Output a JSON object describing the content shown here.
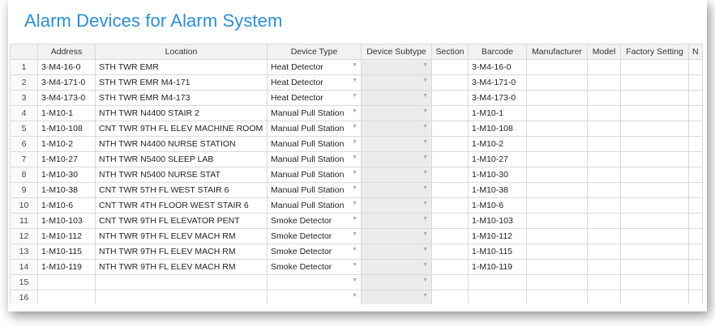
{
  "title": "Alarm Devices for Alarm System",
  "columns": [
    "",
    "Address",
    "Location",
    "Device Type",
    "Device Subtype",
    "Section",
    "Barcode",
    "Manufacturer",
    "Model",
    "Factory Setting",
    "N"
  ],
  "rows": [
    {
      "num": "1",
      "address": "3-M4-16-0",
      "location": "STH TWR EMR",
      "device_type": "Heat Detector",
      "barcode": "3-M4-16-0"
    },
    {
      "num": "2",
      "address": "3-M4-171-0",
      "location": "STH TWR EMR M4-171",
      "device_type": "Heat Detector",
      "barcode": "3-M4-171-0"
    },
    {
      "num": "3",
      "address": "3-M4-173-0",
      "location": "STH TWR EMR M4-173",
      "device_type": "Heat Detector",
      "barcode": "3-M4-173-0"
    },
    {
      "num": "4",
      "address": "1-M10-1",
      "location": "NTH TWR N4400 STAIR 2",
      "device_type": "Manual Pull Station",
      "barcode": "1-M10-1"
    },
    {
      "num": "5",
      "address": "1-M10-108",
      "location": "CNT TWR 9TH FL ELEV MACHINE ROOM",
      "device_type": "Manual Pull Station",
      "barcode": "1-M10-108"
    },
    {
      "num": "6",
      "address": "1-M10-2",
      "location": "NTH TWR N4400 NURSE STATION",
      "device_type": "Manual Pull Station",
      "barcode": "1-M10-2"
    },
    {
      "num": "7",
      "address": "1-M10-27",
      "location": "NTH TWR N5400 SLEEP LAB",
      "device_type": "Manual Pull Station",
      "barcode": "1-M10-27"
    },
    {
      "num": "8",
      "address": "1-M10-30",
      "location": "NTH TWR N5400 NURSE STAT",
      "device_type": "Manual Pull Station",
      "barcode": "1-M10-30"
    },
    {
      "num": "9",
      "address": "1-M10-38",
      "location": "CNT TWR 5TH FL WEST STAIR 6",
      "device_type": "Manual Pull Station",
      "barcode": "1-M10-38"
    },
    {
      "num": "10",
      "address": "1-M10-6",
      "location": "CNT TWR 4TH FLOOR WEST STAIR 6",
      "device_type": "Manual Pull Station",
      "barcode": "1-M10-6"
    },
    {
      "num": "11",
      "address": "1-M10-103",
      "location": "CNT TWR 9TH FL ELEVATOR PENT",
      "device_type": "Smoke Detector",
      "barcode": "1-M10-103"
    },
    {
      "num": "12",
      "address": "1-M10-112",
      "location": "NTH TWR 9TH FL ELEV MACH RM",
      "device_type": "Smoke Detector",
      "barcode": "1-M10-112"
    },
    {
      "num": "13",
      "address": "1-M10-115",
      "location": "NTH TWR 9TH FL ELEV MACH RM",
      "device_type": "Smoke Detector",
      "barcode": "1-M10-115"
    },
    {
      "num": "14",
      "address": "1-M10-119",
      "location": "NTH TWR 9TH FL ELEV MACH RM",
      "device_type": "Smoke Detector",
      "barcode": "1-M10-119"
    },
    {
      "num": "15",
      "address": "",
      "location": "",
      "device_type": "",
      "barcode": ""
    },
    {
      "num": "16",
      "address": "",
      "location": "",
      "device_type": "",
      "barcode": ""
    }
  ],
  "icons": {
    "dropdown": "▼"
  }
}
